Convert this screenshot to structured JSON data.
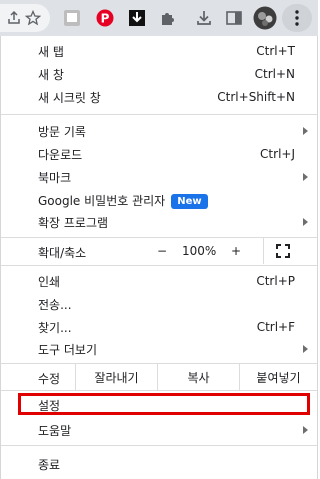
{
  "toolbar": {
    "icons": [
      "share-icon",
      "star-icon",
      "extension-notes-icon",
      "pinterest-icon",
      "download-extension-icon",
      "puzzle-icon",
      "download-icon",
      "side-panel-icon",
      "profile-avatar",
      "menu-kebab-icon"
    ],
    "colors": {
      "pinterest": "#e60023",
      "toolbar_bg": "#dee1e6"
    }
  },
  "menu": {
    "new_tab": {
      "label": "새 탭",
      "shortcut": "Ctrl+T"
    },
    "new_window": {
      "label": "새 창",
      "shortcut": "Ctrl+N"
    },
    "new_incognito": {
      "label": "새 시크릿 창",
      "shortcut": "Ctrl+Shift+N"
    },
    "history": {
      "label": "방문 기록"
    },
    "downloads": {
      "label": "다운로드",
      "shortcut": "Ctrl+J"
    },
    "bookmarks": {
      "label": "북마크"
    },
    "password_manager": {
      "label": "Google 비밀번호 관리자",
      "badge": "New"
    },
    "extensions": {
      "label": "확장 프로그램"
    },
    "zoom": {
      "label": "확대/축소",
      "minus": "−",
      "value": "100%",
      "plus": "+"
    },
    "print": {
      "label": "인쇄",
      "shortcut": "Ctrl+P"
    },
    "cast": {
      "label": "전송..."
    },
    "find": {
      "label": "찾기...",
      "shortcut": "Ctrl+F"
    },
    "more_tools": {
      "label": "도구 더보기"
    },
    "edit": {
      "label": "수정",
      "cut": "잘라내기",
      "copy": "복사",
      "paste": "붙여넣기"
    },
    "settings": {
      "label": "설정"
    },
    "help": {
      "label": "도움말"
    },
    "exit": {
      "label": "종료"
    }
  },
  "highlight_color": "#e00000"
}
